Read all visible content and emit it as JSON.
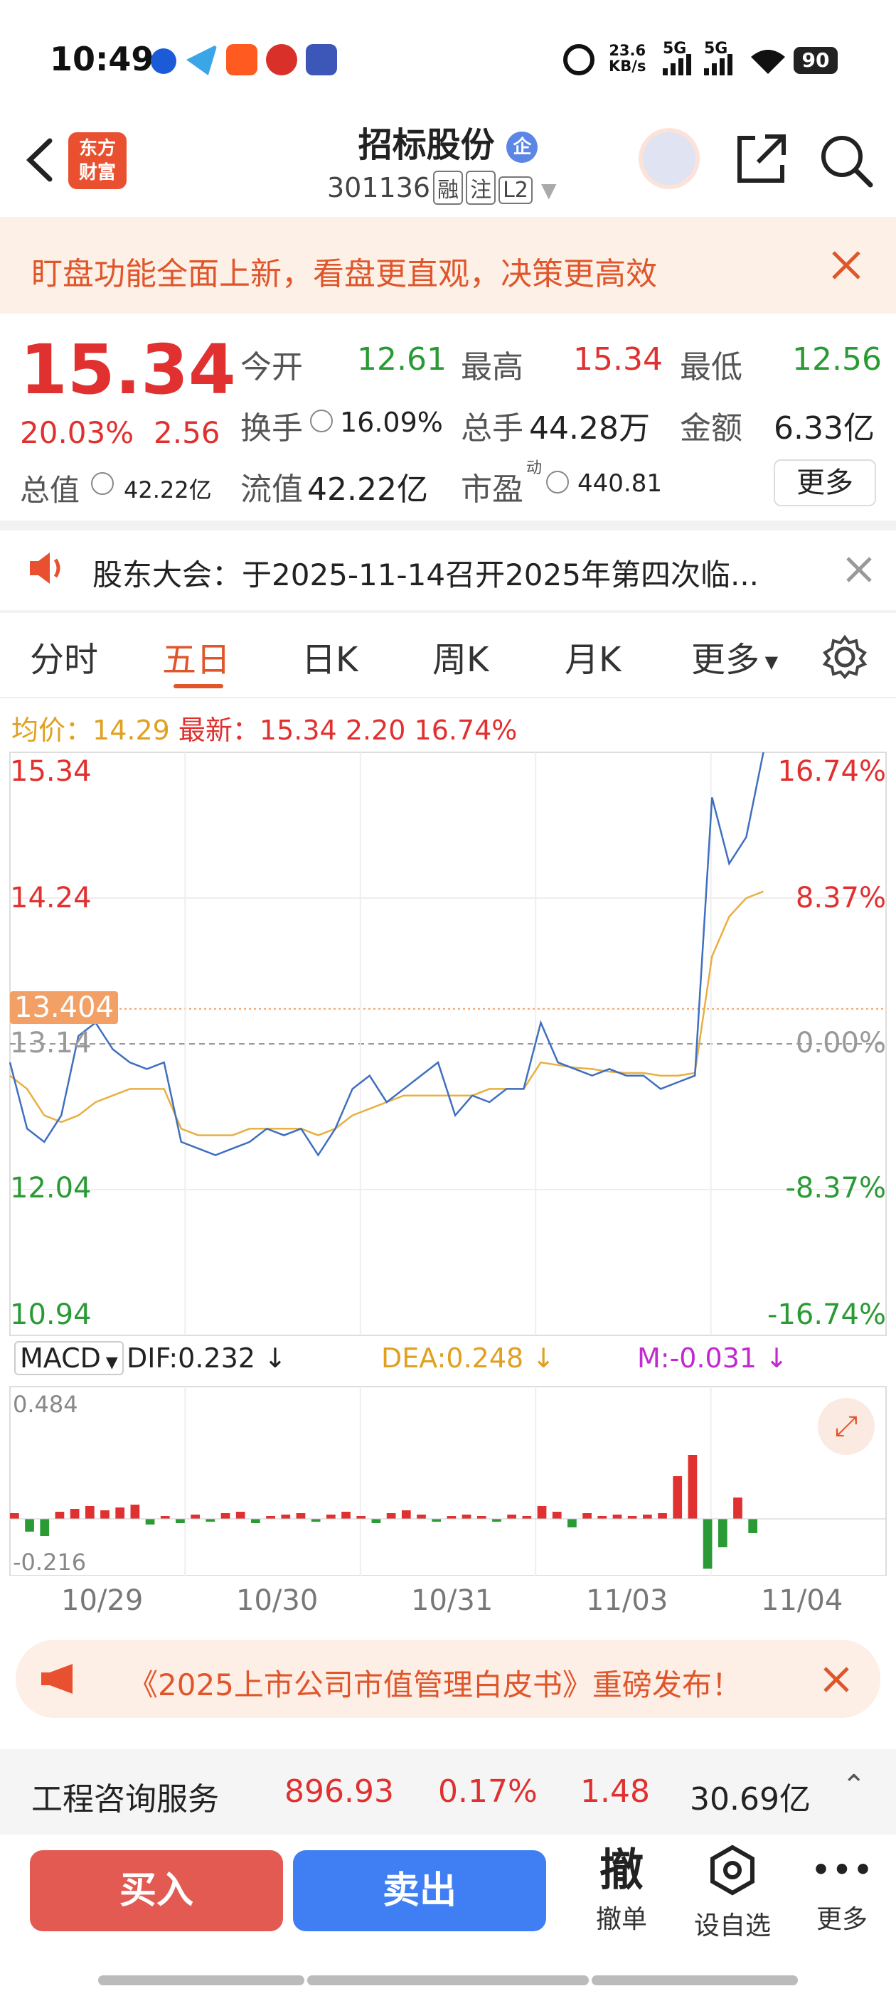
{
  "status": {
    "time": "10:49",
    "net_speed_top": "23.6",
    "net_speed_bottom": "KB/s",
    "sig1": "5G",
    "sig2": "5G",
    "battery": "90"
  },
  "header": {
    "logo_line1": "东方",
    "logo_line2": "财富",
    "title": "招标股份",
    "title_badge": "企",
    "code": "301136",
    "tags": [
      "融",
      "注",
      "L2"
    ]
  },
  "banner": {
    "text": "盯盘功能全面上新，看盘更直观，决策更高效"
  },
  "quote": {
    "price": "15.34",
    "change_pct": "20.03%",
    "change": "2.56",
    "open_label": "今开",
    "open": "12.61",
    "high_label": "最高",
    "high": "15.34",
    "low_label": "最低",
    "low": "12.56",
    "turnover_label": "换手",
    "turnover": "16.09%",
    "volume_label": "总手",
    "volume": "44.28万",
    "amount_label": "金额",
    "amount": "6.33亿",
    "mktcap_label": "总值",
    "mktcap": "42.22亿",
    "float_label": "流值",
    "float": "42.22亿",
    "pe_label": "市盈",
    "pe_sup": "动",
    "pe": "440.81",
    "more": "更多"
  },
  "notice": {
    "text": "股东大会：于2025-11-14召开2025年第四次临..."
  },
  "tabs": [
    "分时",
    "五日",
    "日K",
    "周K",
    "月K",
    "更多"
  ],
  "info_line": {
    "avg_label": "均价：",
    "avg": "14.29",
    "last_label": "最新：",
    "last": "15.34",
    "chg": "2.20",
    "chg_pct": "16.74%"
  },
  "chart_data": {
    "type": "line",
    "price_axis": [
      "15.34",
      "14.24",
      "13.14",
      "12.04",
      "10.94"
    ],
    "pct_axis": [
      "16.74%",
      "8.37%",
      "0.00%",
      "-8.37%",
      "-16.74%"
    ],
    "marker_price": "13.404",
    "dates": [
      "10/29",
      "10/30",
      "10/31",
      "11/03",
      "11/04"
    ],
    "series": [
      {
        "values": [
          13.0,
          12.5,
          12.4,
          12.6,
          13.2,
          13.3,
          13.1,
          13.0,
          12.95,
          13.0,
          12.4,
          12.35,
          12.3,
          12.35,
          12.4,
          12.5,
          12.45,
          12.5,
          12.3,
          12.5,
          12.8,
          12.9,
          12.7,
          12.8,
          12.9,
          13.0,
          12.6,
          12.75,
          12.7,
          12.8,
          12.8,
          13.3,
          13.0,
          12.95,
          12.9,
          12.95,
          12.9,
          12.9,
          12.8,
          12.85,
          12.9,
          15.0,
          14.5,
          14.7,
          15.34
        ]
      },
      {
        "values": [
          12.9,
          12.8,
          12.6,
          12.55,
          12.6,
          12.7,
          12.75,
          12.8,
          12.8,
          12.8,
          12.5,
          12.45,
          12.45,
          12.45,
          12.5,
          12.5,
          12.5,
          12.5,
          12.45,
          12.5,
          12.6,
          12.65,
          12.7,
          12.75,
          12.75,
          12.75,
          12.75,
          12.75,
          12.8,
          12.8,
          12.8,
          13.0,
          12.98,
          12.96,
          12.95,
          12.93,
          12.92,
          12.92,
          12.9,
          12.9,
          12.92,
          13.8,
          14.1,
          14.24,
          14.29
        ]
      }
    ]
  },
  "macd": {
    "label": "MACD",
    "dif": "DIF:0.232",
    "dea": "DEA:0.248",
    "m": "M:-0.031",
    "top": "0.484",
    "bottom": "-0.216"
  },
  "ad": {
    "text": "《2025上市公司市值管理白皮书》重磅发布！"
  },
  "sector": {
    "name": "工程咨询服务",
    "price": "896.93",
    "pct": "0.17%",
    "chg": "1.48",
    "amount": "30.69亿"
  },
  "actions": {
    "buy": "买入",
    "sell": "卖出",
    "cancel_char": "撤",
    "cancel": "撤单",
    "watch": "设自选",
    "more": "更多"
  },
  "colors": {
    "red": "#e0302f",
    "green": "#2a9a35",
    "accent": "#e0552a",
    "buy": "#e35a52",
    "sell": "#3f7ff3"
  }
}
